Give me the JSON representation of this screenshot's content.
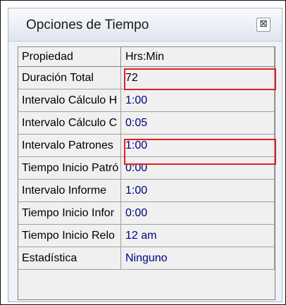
{
  "window": {
    "title": "Opciones de Tiempo",
    "close_icon": "close-icon"
  },
  "grid": {
    "header": {
      "property": "Propiedad",
      "value": "Hrs:Min"
    },
    "rows": [
      {
        "property": "Duración Total",
        "value": "72",
        "highlighted": true
      },
      {
        "property": "Intervalo Cálculo H",
        "value": "1:00"
      },
      {
        "property": "Intervalo Cálculo C",
        "value": "0:05"
      },
      {
        "property": "Intervalo Patrones",
        "value": "1:00",
        "highlighted": true
      },
      {
        "property": "Tiempo Inicio Patró",
        "value": "0:00"
      },
      {
        "property": "Intervalo Informe",
        "value": "1:00"
      },
      {
        "property": "Tiempo Inicio Infor",
        "value": "0:00"
      },
      {
        "property": "Tiempo Inicio Relo",
        "value": "12 am"
      },
      {
        "property": "Estadística",
        "value": "Ninguno"
      }
    ]
  },
  "colors": {
    "value_text": "#000080",
    "highlight_border": "#e02020"
  }
}
